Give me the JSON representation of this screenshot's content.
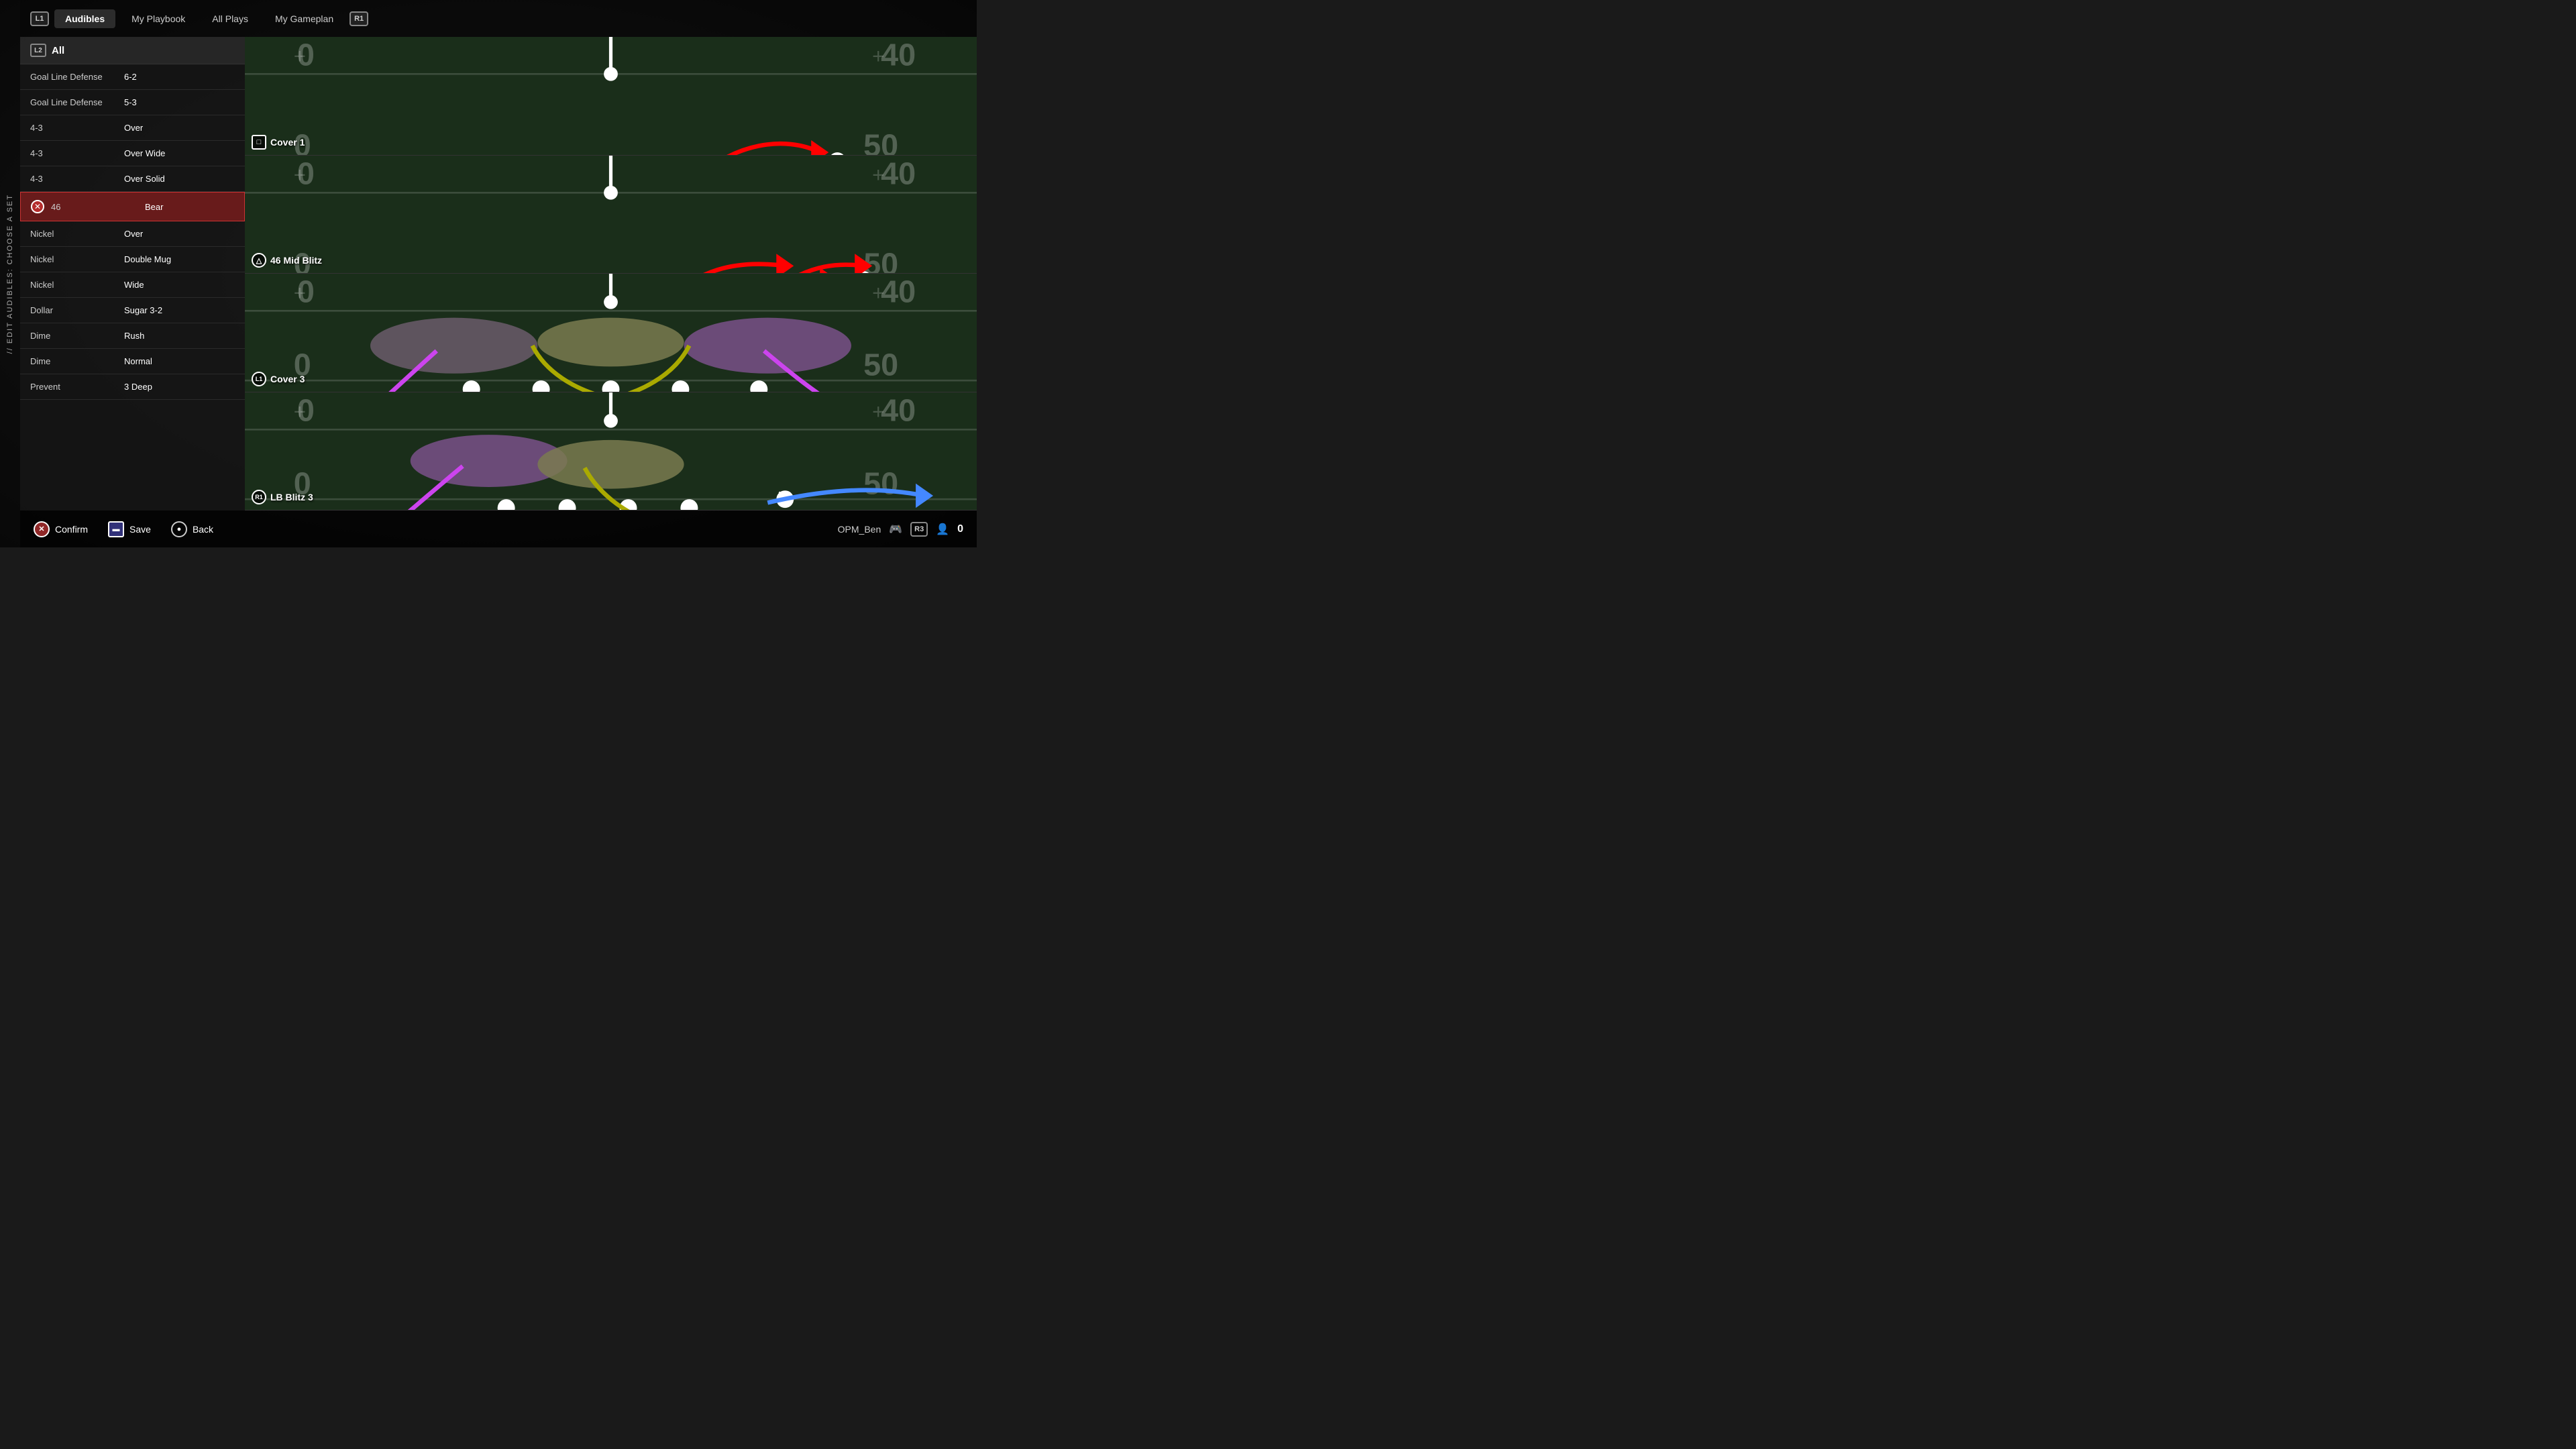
{
  "nav": {
    "l1_badge": "L1",
    "r1_badge": "R1",
    "tabs": [
      {
        "id": "audibles",
        "label": "Audibles",
        "active": true
      },
      {
        "id": "my-playbook",
        "label": "My Playbook",
        "active": false
      },
      {
        "id": "all-plays",
        "label": "All Plays",
        "active": false
      },
      {
        "id": "my-gameplan",
        "label": "My Gameplan",
        "active": false
      }
    ]
  },
  "side_label": "// EDIT AUDIBLES: CHOOSE A SET",
  "category": {
    "badge": "L2",
    "label": "All"
  },
  "plays": [
    {
      "formation": "Goal Line Defense",
      "play": "6-2",
      "selected": false
    },
    {
      "formation": "Goal Line Defense",
      "play": "5-3",
      "selected": false
    },
    {
      "formation": "4-3",
      "play": "Over",
      "selected": false
    },
    {
      "formation": "4-3",
      "play": "Over Wide",
      "selected": false
    },
    {
      "formation": "4-3",
      "play": "Over Solid",
      "selected": false
    },
    {
      "formation": "46",
      "play": "Bear",
      "selected": true
    },
    {
      "formation": "Nickel",
      "play": "Over",
      "selected": false
    },
    {
      "formation": "Nickel",
      "play": "Double Mug",
      "selected": false
    },
    {
      "formation": "Nickel",
      "play": "Wide",
      "selected": false
    },
    {
      "formation": "Dollar",
      "play": "Sugar 3-2",
      "selected": false
    },
    {
      "formation": "Dime",
      "play": "Rush",
      "selected": false
    },
    {
      "formation": "Dime",
      "play": "Normal",
      "selected": false
    },
    {
      "formation": "Prevent",
      "play": "3 Deep",
      "selected": false
    }
  ],
  "audible_plays": [
    {
      "badge_type": "square",
      "badge_label": "□",
      "name": "Cover 1",
      "slot": "square"
    },
    {
      "badge_type": "triangle",
      "badge_label": "△",
      "name": "46 Mid Blitz",
      "slot": "triangle"
    },
    {
      "badge_type": "l1",
      "badge_label": "L1",
      "name": "Cover 3",
      "slot": "l1"
    },
    {
      "badge_type": "r1",
      "badge_label": "R1",
      "name": "LB Blitz 3",
      "slot": "r1"
    }
  ],
  "bottom_bar": {
    "actions": [
      {
        "icon": "✕",
        "icon_type": "circle",
        "label": "Confirm"
      },
      {
        "icon": "▬",
        "icon_type": "square",
        "label": "Save"
      },
      {
        "icon": "●",
        "icon_type": "circle-filled",
        "label": "Back"
      }
    ],
    "username": "OPM_Ben",
    "r3_badge": "R3",
    "score": "0"
  }
}
